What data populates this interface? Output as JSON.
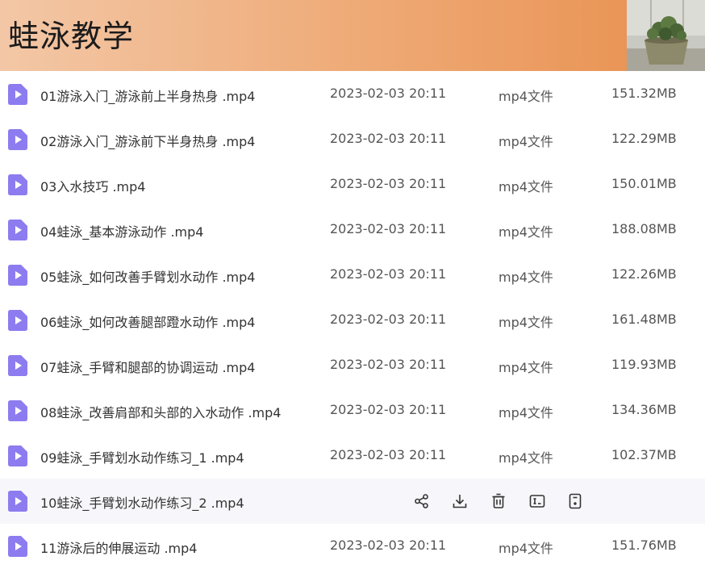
{
  "banner": {
    "title": "蛙泳教学"
  },
  "files": [
    {
      "name": "01游泳入门_游泳前上半身热身 .mp4",
      "date": "2023-02-03 20:11",
      "type": "mp4文件",
      "size": "151.32MB"
    },
    {
      "name": "02游泳入门_游泳前下半身热身 .mp4",
      "date": "2023-02-03 20:11",
      "type": "mp4文件",
      "size": "122.29MB"
    },
    {
      "name": "03入水技巧 .mp4",
      "date": "2023-02-03 20:11",
      "type": "mp4文件",
      "size": "150.01MB"
    },
    {
      "name": "04蛙泳_基本游泳动作 .mp4",
      "date": "2023-02-03 20:11",
      "type": "mp4文件",
      "size": "188.08MB"
    },
    {
      "name": "05蛙泳_如何改善手臂划水动作 .mp4",
      "date": "2023-02-03 20:11",
      "type": "mp4文件",
      "size": "122.26MB"
    },
    {
      "name": "06蛙泳_如何改善腿部蹬水动作 .mp4",
      "date": "2023-02-03 20:11",
      "type": "mp4文件",
      "size": "161.48MB"
    },
    {
      "name": "07蛙泳_手臂和腿部的协调运动 .mp4",
      "date": "2023-02-03 20:11",
      "type": "mp4文件",
      "size": "119.93MB"
    },
    {
      "name": "08蛙泳_改善肩部和头部的入水动作 .mp4",
      "date": "2023-02-03 20:11",
      "type": "mp4文件",
      "size": "134.36MB"
    },
    {
      "name": "09蛙泳_手臂划水动作练习_1 .mp4",
      "date": "2023-02-03 20:11",
      "type": "mp4文件",
      "size": "102.37MB"
    },
    {
      "name": "10蛙泳_手臂划水动作练习_2 .mp4"
    },
    {
      "name": "11游泳后的伸展运动 .mp4",
      "date": "2023-02-03 20:11",
      "type": "mp4文件",
      "size": "151.76MB"
    }
  ],
  "icons": {
    "file": "video-file-icon",
    "actions": [
      "share-icon",
      "download-icon",
      "delete-icon",
      "rename-icon",
      "more-icon"
    ]
  },
  "colors": {
    "file_icon": "#8c7cf0",
    "banner_start": "#f3c7a6",
    "banner_end": "#e98f4e",
    "hover_row": "#f7f7fb"
  }
}
